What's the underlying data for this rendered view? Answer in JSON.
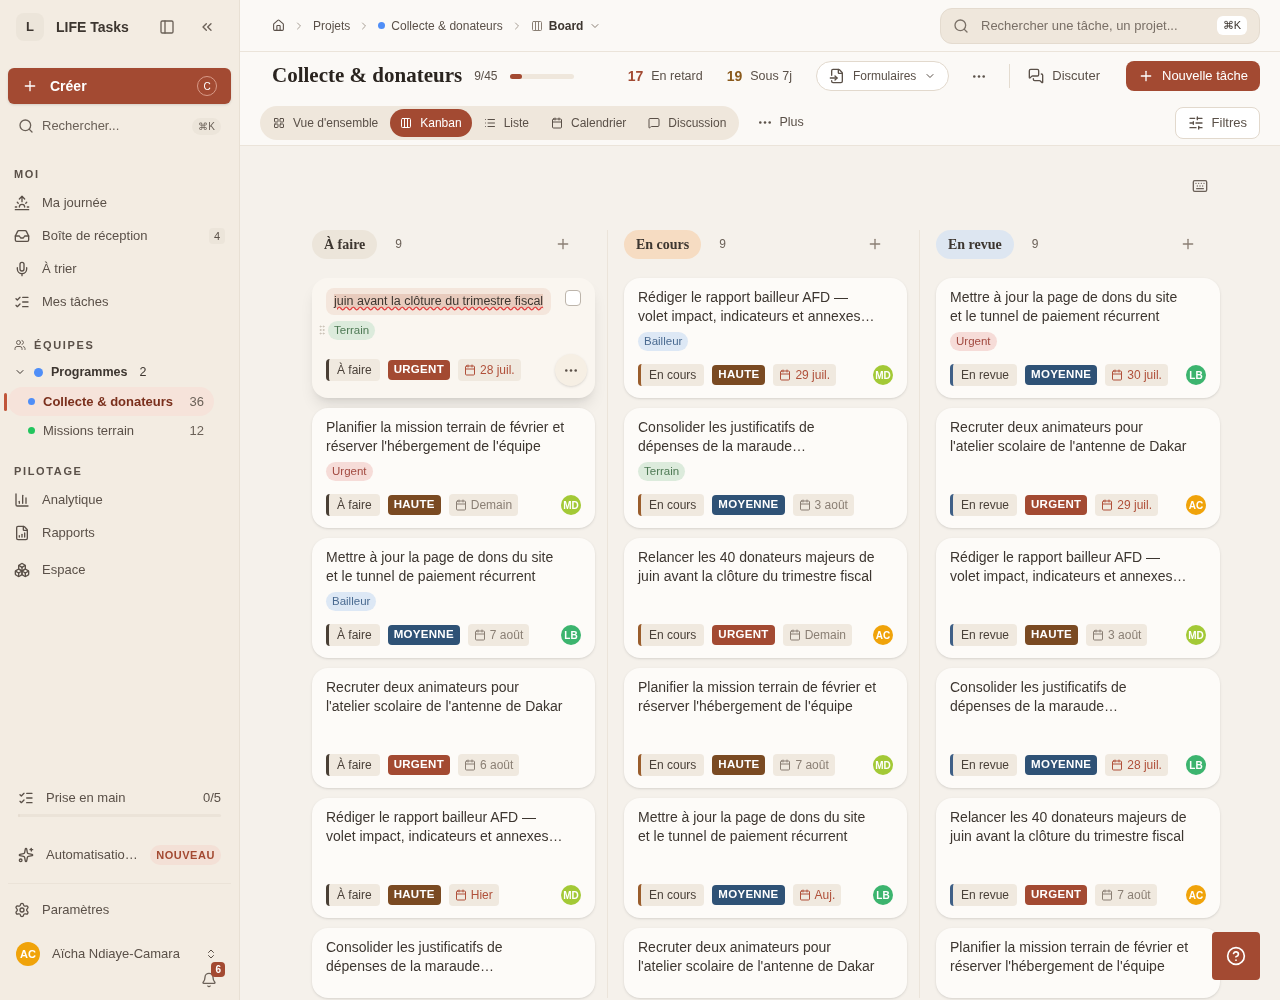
{
  "sidebar": {
    "workspace_initial": "L",
    "workspace_name": "LIFE Tasks",
    "create": {
      "label": "Créer",
      "shortcut": "C"
    },
    "search": {
      "placeholder": "Rechercher...",
      "shortcut": "⌘K"
    },
    "sections": [
      {
        "title": "MOI",
        "kind": "plain",
        "items": [
          {
            "label": "Ma journée"
          },
          {
            "label": "Boîte de réception",
            "count": "4"
          },
          {
            "label": "À trier"
          },
          {
            "label": "Mes tâches"
          }
        ]
      },
      {
        "title": "ÉQUIPES",
        "kind": "teams",
        "items": [
          {
            "label": "Programmes",
            "count": "2",
            "expanded": true,
            "color": "#4f8ef7",
            "children": [
              {
                "label": "Collecte & donateurs",
                "count": "36",
                "selected": true,
                "color": "#4f8ef7"
              },
              {
                "label": "Missions terrain",
                "count": "12",
                "selected": false,
                "color": "#22c55e"
              }
            ]
          }
        ]
      },
      {
        "title": "PILOTAGE",
        "kind": "plain",
        "items": [
          {
            "label": "Analytique"
          },
          {
            "label": "Rapports"
          },
          {
            "label": "Espace"
          }
        ]
      }
    ],
    "onboarding": {
      "label": "Prise en main",
      "progress": "0/5",
      "level": 0
    },
    "automation": {
      "label": "Automatisatio…",
      "badge": "NOUVEAU"
    },
    "settings": "Paramètres",
    "user": {
      "initials": "AC",
      "name": "Aïcha Ndiaye-Camara",
      "color": "#f0a30a"
    },
    "notifications": "6"
  },
  "breadcrumb": [
    {
      "label": "Projets"
    },
    {
      "label": "Collecte & donateurs",
      "color": "#4f8ef7"
    },
    {
      "label": "Board"
    }
  ],
  "top_search": {
    "placeholder": "Rechercher une tâche, un projet...",
    "shortcut": "⌘K"
  },
  "project": {
    "title": "Collecte & donateurs",
    "progress": "9/45",
    "level": 0.2,
    "stats": [
      {
        "value": "17",
        "label": "En retard",
        "color": "#a24a32"
      },
      {
        "value": "19",
        "label": "Sous 7j",
        "color": "#8a5a1c"
      }
    ],
    "forms": "Formulaires",
    "discuss": "Discuter",
    "new_task": "Nouvelle tâche"
  },
  "tabs": [
    {
      "label": "Vue d'ensemble",
      "selected": false
    },
    {
      "label": "Kanban",
      "selected": true
    },
    {
      "label": "Liste",
      "selected": false
    },
    {
      "label": "Calendrier",
      "selected": false
    },
    {
      "label": "Discussion",
      "selected": false
    }
  ],
  "more": "Plus",
  "filters": "Filtres",
  "columns": [
    {
      "title": "À faire",
      "count": "9",
      "kind": "todo",
      "cards": [
        {
          "title": "juin avant la clôture du trimestre fiscal",
          "editing": true,
          "checked": false,
          "tag": {
            "label": "Terrain",
            "kind": "terrain"
          },
          "status": "À faire",
          "priority": {
            "label": "URGENT",
            "kind": "urgent"
          },
          "date": {
            "label": "28 juil.",
            "overdue": true
          }
        },
        {
          "title": "Planifier la mission terrain de février et réserver l'hébergement de l'équipe",
          "editing": false,
          "tag": {
            "label": "Urgent",
            "kind": "urgent"
          },
          "status": "À faire",
          "priority": {
            "label": "HAUTE",
            "kind": "haute"
          },
          "date": {
            "label": "Demain",
            "overdue": false
          },
          "avatar": {
            "initials": "MD",
            "color": "#a3c936"
          }
        },
        {
          "title": "Mettre à jour la page de dons du site et le tunnel de paiement récurrent",
          "editing": false,
          "tag": {
            "label": "Bailleur",
            "kind": "bailleur"
          },
          "status": "À faire",
          "priority": {
            "label": "MOYENNE",
            "kind": "moyenne"
          },
          "date": {
            "label": "7 août",
            "overdue": false
          },
          "avatar": {
            "initials": "LB",
            "color": "#3cb46e"
          }
        },
        {
          "title": "Recruter deux animateurs pour l'atelier scolaire de l'antenne de Dakar",
          "editing": false,
          "status": "À faire",
          "priority": {
            "label": "URGENT",
            "kind": "urgent"
          },
          "date": {
            "label": "6 août",
            "overdue": false
          }
        },
        {
          "title": "Rédiger le rapport bailleur AFD — volet impact, indicateurs et annexes…",
          "editing": false,
          "status": "À faire",
          "priority": {
            "label": "HAUTE",
            "kind": "haute"
          },
          "date": {
            "label": "Hier",
            "overdue": true
          },
          "avatar": {
            "initials": "MD",
            "color": "#a3c936"
          }
        },
        {
          "title": "Consolider les justificatifs de dépenses de la maraude…",
          "partial": true
        }
      ]
    },
    {
      "title": "En cours",
      "count": "9",
      "kind": "doing",
      "cards": [
        {
          "title": "Rédiger le rapport bailleur AFD — volet impact, indicateurs et annexes…",
          "editing": false,
          "tag": {
            "label": "Bailleur",
            "kind": "bailleur"
          },
          "status": "En cours",
          "priority": {
            "label": "HAUTE",
            "kind": "haute"
          },
          "date": {
            "label": "29 juil.",
            "overdue": true
          },
          "avatar": {
            "initials": "MD",
            "color": "#a3c936"
          }
        },
        {
          "title": "Consolider les justificatifs de dépenses de la maraude…",
          "editing": false,
          "tag": {
            "label": "Terrain",
            "kind": "terrain"
          },
          "status": "En cours",
          "priority": {
            "label": "MOYENNE",
            "kind": "moyenne"
          },
          "date": {
            "label": "3 août",
            "overdue": false
          }
        },
        {
          "title": "Relancer les 40 donateurs majeurs de juin avant la clôture du trimestre fiscal",
          "editing": false,
          "status": "En cours",
          "priority": {
            "label": "URGENT",
            "kind": "urgent"
          },
          "date": {
            "label": "Demain",
            "overdue": false
          },
          "avatar": {
            "initials": "AC",
            "color": "#f0a30a"
          }
        },
        {
          "title": "Planifier la mission terrain de février et réserver l'hébergement de l'équipe",
          "editing": false,
          "status": "En cours",
          "priority": {
            "label": "HAUTE",
            "kind": "haute"
          },
          "date": {
            "label": "7 août",
            "overdue": false
          },
          "avatar": {
            "initials": "MD",
            "color": "#a3c936"
          }
        },
        {
          "title": "Mettre à jour la page de dons du site et le tunnel de paiement récurrent",
          "editing": false,
          "status": "En cours",
          "priority": {
            "label": "MOYENNE",
            "kind": "moyenne"
          },
          "date": {
            "label": "Auj.",
            "overdue": true
          },
          "avatar": {
            "initials": "LB",
            "color": "#3cb46e"
          }
        },
        {
          "title": "Recruter deux animateurs pour l'atelier scolaire de l'antenne de Dakar",
          "partial": true
        }
      ]
    },
    {
      "title": "En revue",
      "count": "9",
      "kind": "review",
      "cards": [
        {
          "title": "Mettre à jour la page de dons du site et le tunnel de paiement récurrent",
          "editing": false,
          "tag": {
            "label": "Urgent",
            "kind": "urgent"
          },
          "status": "En revue",
          "priority": {
            "label": "MOYENNE",
            "kind": "moyenne"
          },
          "date": {
            "label": "30 juil.",
            "overdue": true
          },
          "avatar": {
            "initials": "LB",
            "color": "#3cb46e"
          }
        },
        {
          "title": "Recruter deux animateurs pour l'atelier scolaire de l'antenne de Dakar",
          "editing": false,
          "status": "En revue",
          "priority": {
            "label": "URGENT",
            "kind": "urgent"
          },
          "date": {
            "label": "29 juil.",
            "overdue": true
          },
          "avatar": {
            "initials": "AC",
            "color": "#f0a30a"
          }
        },
        {
          "title": "Rédiger le rapport bailleur AFD — volet impact, indicateurs et annexes…",
          "editing": false,
          "status": "En revue",
          "priority": {
            "label": "HAUTE",
            "kind": "haute"
          },
          "date": {
            "label": "3 août",
            "overdue": false
          },
          "avatar": {
            "initials": "MD",
            "color": "#a3c936"
          }
        },
        {
          "title": "Consolider les justificatifs de dépenses de la maraude…",
          "editing": false,
          "status": "En revue",
          "priority": {
            "label": "MOYENNE",
            "kind": "moyenne"
          },
          "date": {
            "label": "28 juil.",
            "overdue": true
          },
          "avatar": {
            "initials": "LB",
            "color": "#3cb46e"
          }
        },
        {
          "title": "Relancer les 40 donateurs majeurs de juin avant la clôture du trimestre fiscal",
          "editing": false,
          "status": "En revue",
          "priority": {
            "label": "URGENT",
            "kind": "urgent"
          },
          "date": {
            "label": "7 août",
            "overdue": false
          },
          "avatar": {
            "initials": "AC",
            "color": "#f0a30a"
          }
        },
        {
          "title": "Planifier la mission terrain de février et réserver l'hébergement de l'équipe",
          "partial": true
        }
      ]
    }
  ]
}
